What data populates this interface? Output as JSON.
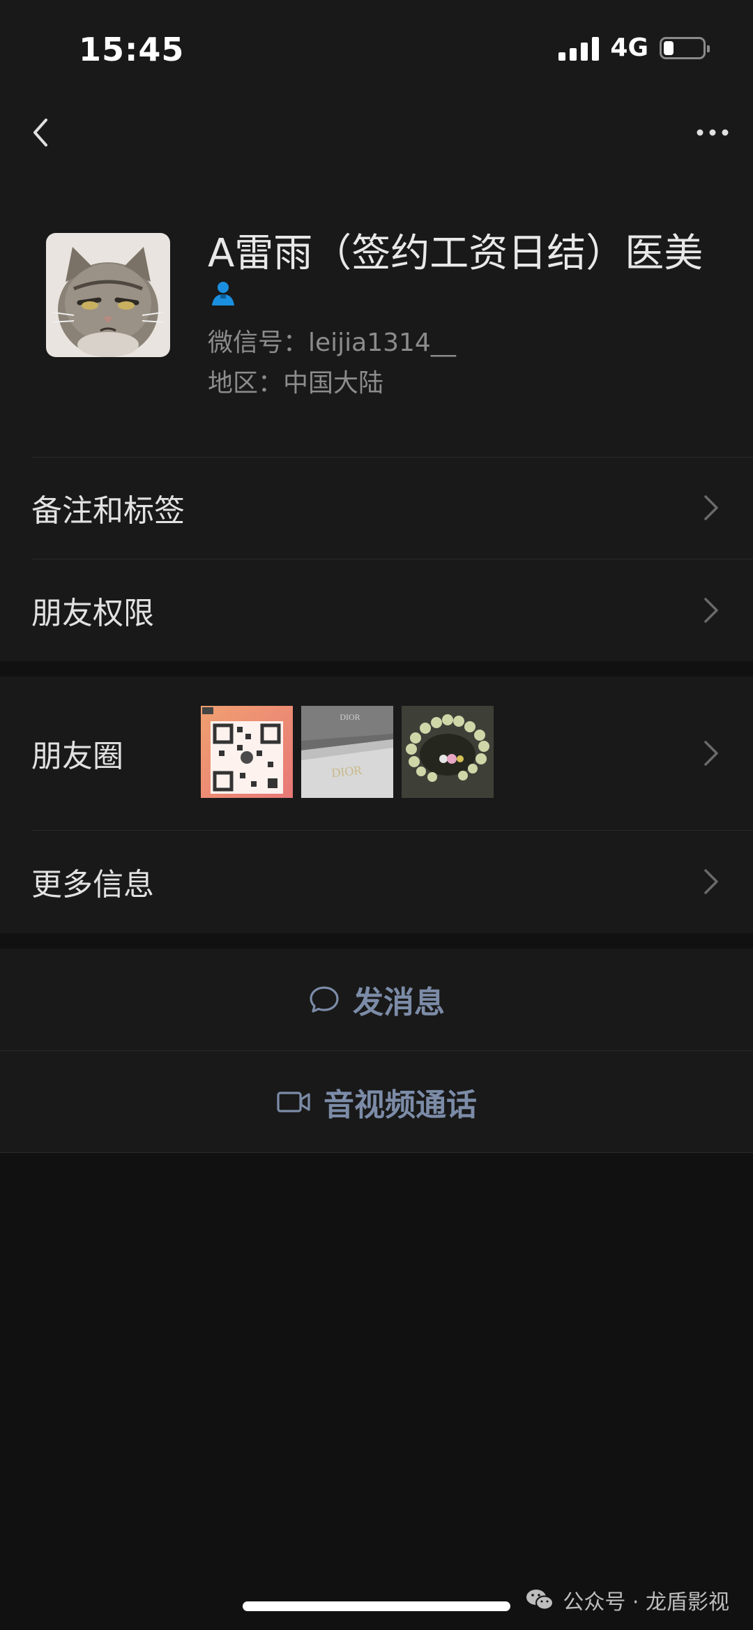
{
  "status_bar": {
    "time": "15:45",
    "network": "4G"
  },
  "nav": {
    "back_icon": "chevron-left-icon",
    "more_icon": "ellipsis-icon"
  },
  "profile": {
    "name": "A雷雨（签约工资日结）医美",
    "wechat_id": "微信号：leijia1314__",
    "region": "地区：中国大陆",
    "badge_icon": "person-badge-icon"
  },
  "menu": {
    "remarks_tags": "备注和标签",
    "friend_permissions": "朋友权限",
    "moments": "朋友圈",
    "more_info": "更多信息"
  },
  "moments_thumbs": [
    {
      "name": "qr-code-thumbnail",
      "label": "QR code"
    },
    {
      "name": "dior-box-thumbnail",
      "label": "DIOR"
    },
    {
      "name": "bracelet-thumbnail",
      "label": "bracelet"
    }
  ],
  "actions": {
    "send_message": "发消息",
    "video_call": "音视频通话"
  },
  "watermark": {
    "text": "公众号 · 龙盾影视"
  },
  "colors": {
    "background": "#111111",
    "surface": "#191919",
    "action_text": "#7c8ca8",
    "badge_blue": "#1a8fe0"
  }
}
